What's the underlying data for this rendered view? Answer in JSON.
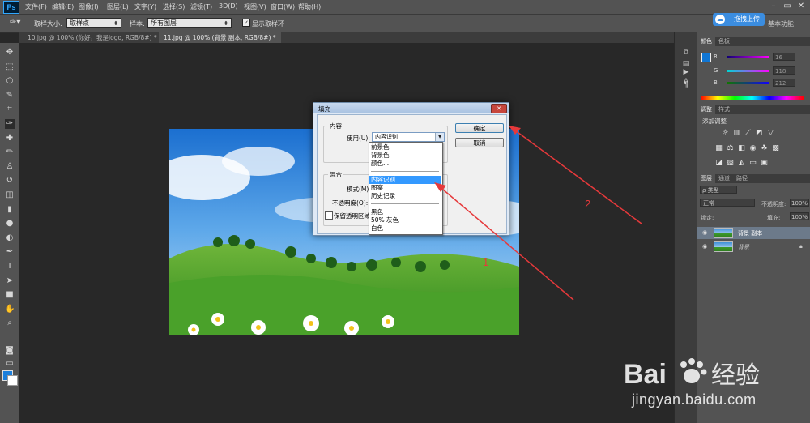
{
  "app": {
    "logo": "Ps"
  },
  "menu": [
    "文件(F)",
    "编辑(E)",
    "图像(I)",
    "图层(L)",
    "文字(Y)",
    "选择(S)",
    "滤镜(T)",
    "3D(D)",
    "视图(V)",
    "窗口(W)",
    "帮助(H)"
  ],
  "window_controls": {
    "minimize": "–",
    "restore": "▭",
    "close": "✕"
  },
  "options_bar": {
    "sample_size_label": "取样大小:",
    "sample_size_value": "取样点",
    "sample_label": "样本:",
    "sample_value": "所有图层",
    "show_ring_label": "显示取样环",
    "upload_button": "拖拽上传",
    "workspace": "基本功能"
  },
  "tabs": [
    {
      "label": "10.jpg @ 100% (你好，我是logo, RGB/8#) *"
    },
    {
      "label": "11.jpg @ 100% (背景 副本, RGB/8#) *"
    }
  ],
  "tools": [
    "move-icon",
    "marquee-icon",
    "lasso-icon",
    "quick-select-icon",
    "crop-icon",
    "eyedropper-icon",
    "spot-heal-icon",
    "brush-icon",
    "clone-stamp-icon",
    "history-brush-icon",
    "eraser-icon",
    "gradient-icon",
    "blur-icon",
    "dodge-icon",
    "pen-icon",
    "type-icon",
    "path-select-icon",
    "shape-icon",
    "hand-icon",
    "zoom-icon"
  ],
  "tool_glyphs": [
    "✥",
    "⬚",
    "○",
    "✎",
    "⌗",
    "✑",
    "✚",
    "✏",
    "♙",
    "↺",
    "◫",
    "▮",
    "●",
    "◐",
    "✒",
    "T",
    "➤",
    "■",
    "✋",
    "⌕"
  ],
  "color_panel": {
    "tabs": [
      "颜色",
      "色板"
    ],
    "r_label": "R",
    "g_label": "G",
    "b_label": "B",
    "r_value": "16",
    "g_value": "118",
    "b_value": "212"
  },
  "adjustments_panel": {
    "tabs": [
      "调整",
      "样式"
    ],
    "heading": "添加调整"
  },
  "layers_panel": {
    "tabs": [
      "图层",
      "通道",
      "路径"
    ],
    "filter": "ρ 类型",
    "blend_mode": "正常",
    "opacity_label": "不透明度:",
    "opacity_value": "100%",
    "lock_label": "锁定:",
    "fill_label": "填充:",
    "fill_value": "100%",
    "layers": [
      {
        "name": "背景 副本"
      },
      {
        "name": "背景"
      }
    ]
  },
  "dialog": {
    "title": "填充",
    "content_group": "内容",
    "use_label": "使用(U):",
    "use_value": "内容识别",
    "ok": "确定",
    "cancel": "取消",
    "blend_group": "混合",
    "mode_label": "模式(M):",
    "opacity_label": "不透明度(O):",
    "preserve_label": "保留透明区域",
    "dropdown_options": [
      "前景色",
      "背景色",
      "颜色...",
      "内容识别",
      "图案",
      "历史记录",
      "黑色",
      "50% 灰色",
      "白色"
    ],
    "selected_option": "内容识别"
  },
  "annotations": {
    "one": "1",
    "two": "2"
  },
  "watermark": {
    "logo_text": "Bai du 经验",
    "url": "jingyan.baidu.com"
  }
}
